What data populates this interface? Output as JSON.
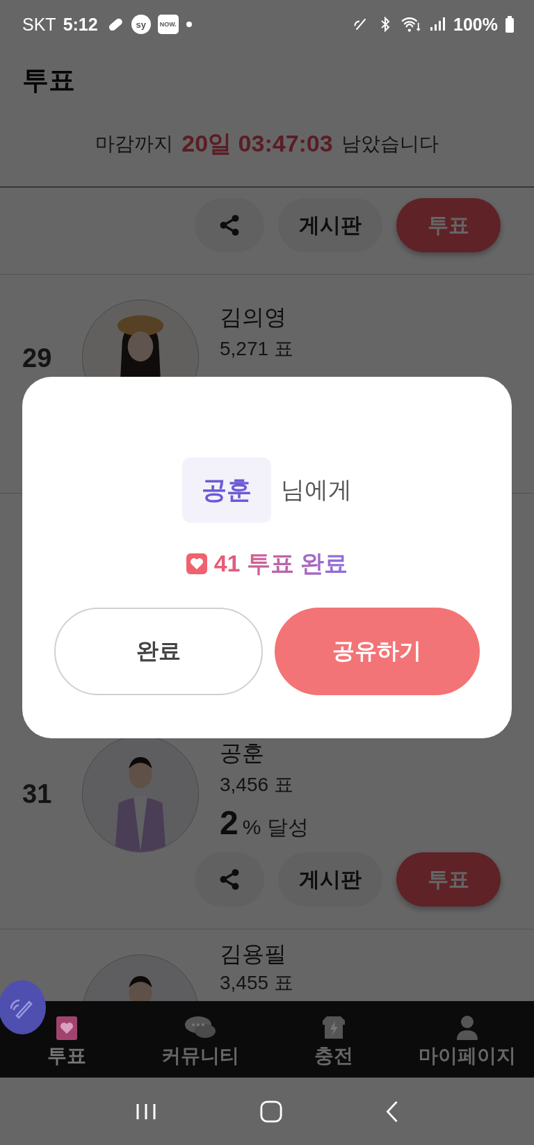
{
  "status_bar": {
    "carrier": "SKT",
    "time": "5:12",
    "notifications": [
      "sy",
      "NOW."
    ],
    "battery": "100%"
  },
  "header": {
    "title": "투표"
  },
  "countdown": {
    "prefix": "마감까지",
    "remaining": "20일 03:47:03",
    "suffix": "남았습니다"
  },
  "list_above": [
    {
      "kind": "actions",
      "actions": {
        "board": "게시판",
        "vote": "투표"
      }
    },
    {
      "kind": "entry",
      "rank": "29",
      "name": "김의영",
      "votes": "5,271 표"
    }
  ],
  "list_below": [
    {
      "kind": "entry",
      "rank": "31",
      "name": "공훈",
      "votes": "3,456 표",
      "percent": "2",
      "percent_unit": "% 달성",
      "actions": {
        "board": "게시판",
        "vote": "투표"
      }
    },
    {
      "kind": "entry",
      "name": "김용필",
      "votes": "3,455 표"
    }
  ],
  "dialog": {
    "recipient": "공훈",
    "recipient_suffix": "님에게",
    "result": "41 투표 완료",
    "buttons": [
      {
        "label": "완료",
        "kind": "secondary"
      },
      {
        "label": "공유하기",
        "kind": "primary"
      }
    ]
  },
  "bottom_nav": [
    {
      "label": "투표",
      "selected": true
    },
    {
      "label": "커뮤니티",
      "selected": false
    },
    {
      "label": "충전",
      "selected": false
    },
    {
      "label": "마이페이지",
      "selected": false
    }
  ]
}
